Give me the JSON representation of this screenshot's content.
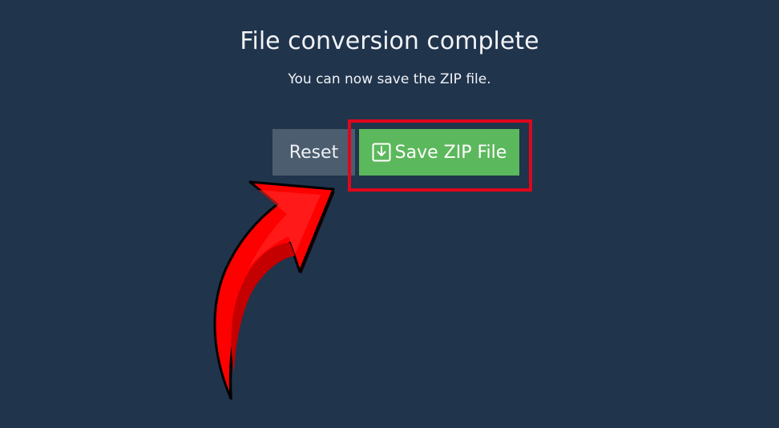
{
  "dialog": {
    "title": "File conversion complete",
    "subtitle": "You can now save the ZIP file."
  },
  "buttons": {
    "reset_label": "Reset",
    "save_label": "Save ZIP File",
    "save_icon": "download-icon"
  },
  "annotation": {
    "highlight_color": "#e0061c",
    "arrow_color": "#ff0000"
  },
  "colors": {
    "background": "#20344c",
    "reset_button": "#4b5d6e",
    "save_button": "#5cb85c"
  }
}
